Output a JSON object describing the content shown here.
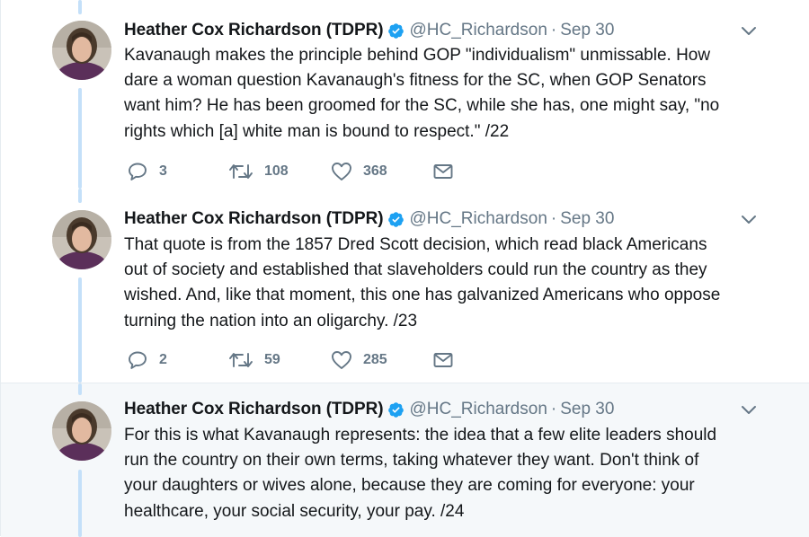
{
  "tweets": [
    {
      "author": "Heather Cox Richardson (TDPR)",
      "handle": "@HC_Richardson",
      "separator": "·",
      "date": "Sep 30",
      "text_lines": [
        "Kavanaugh makes the principle behind GOP \"individualism\" unmissable. How",
        "dare a woman question Kavanaugh's fitness for the SC, when GOP Senators",
        "want him? He has been groomed for the SC, while she has, one might say, \"no",
        "rights which [a] white man is bound to respect.\" /22"
      ],
      "replies": "3",
      "retweets": "108",
      "likes": "368"
    },
    {
      "author": "Heather Cox Richardson (TDPR)",
      "handle": "@HC_Richardson",
      "separator": "·",
      "date": "Sep 30",
      "text_lines": [
        "That quote is from the 1857 Dred Scott decision, which read black Americans",
        "out of society and established that slaveholders could run the country as they",
        "wished. And, like that moment, this one has galvanized Americans who oppose",
        "turning the nation into an oligarchy. /23"
      ],
      "replies": "2",
      "retweets": "59",
      "likes": "285"
    },
    {
      "author": "Heather Cox Richardson (TDPR)",
      "handle": "@HC_Richardson",
      "separator": "·",
      "date": "Sep 30",
      "text_lines": [
        "For this is what Kavanaugh represents: the idea that a few elite leaders should",
        "run the country on their own terms, taking whatever they want. Don't think of",
        "your daughters or wives alone, because they are coming for everyone: your",
        "healthcare, your social security, your pay. /24"
      ]
    }
  ],
  "icons": {
    "reply": "reply-icon",
    "retweet": "retweet-icon",
    "like": "heart-icon",
    "dm": "mail-icon",
    "verified": "verified-badge-icon",
    "caret": "chevron-down-icon"
  },
  "colors": {
    "thread_line": "#c4e0f9",
    "verified": "#1da1f2",
    "secondary_text": "#657786",
    "highlight_bg": "#f5f8fa"
  }
}
